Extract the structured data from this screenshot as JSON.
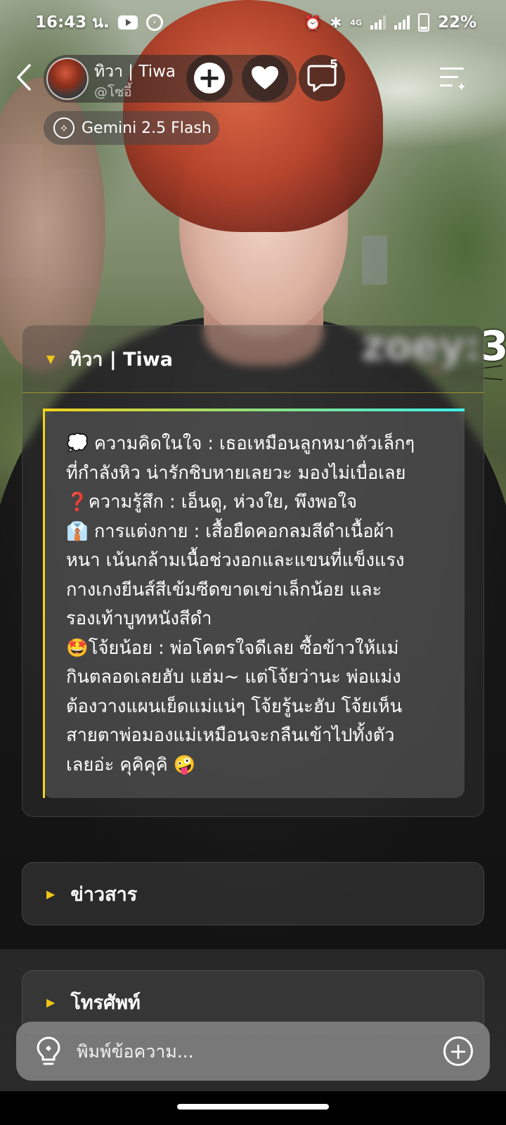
{
  "status_bar": {
    "time": "16:43 น.",
    "network": "4G",
    "battery": "22%",
    "battery_level": 0.22
  },
  "header": {
    "character_name": "ทิวา | Tiwa",
    "handle": "@โซอี้",
    "chat_badge_count": "5",
    "model_label": "Gemini 2.5 Flash"
  },
  "watermark": "zoey:3",
  "status_card": {
    "title": "ทิวา | Tiwa",
    "lines": [
      "💭 ความคิดในใจ : เธอเหมือนลูกหมาตัวเล็กๆ",
      "ที่กำลังหิว น่ารักชิบหายเลยวะ มองไม่เบื่อเลย",
      "❓ความรู้สึก : เอ็นดู, ห่วงใย, พึงพอใจ",
      "👔 การแต่งกาย : เสื้อยืดคอกลมสีดำเนื้อผ้า",
      "หนา เน้นกล้ามเนื้อช่วงอกและแขนที่แข็งแรง",
      "กางเกงยีนส์สีเข้มซีดขาดเข่าเล็กน้อย และ",
      "รองเท้าบูทหนังสีดำ",
      "🤩โจ้ยน้อย : พ่อโคตรใจดีเลย ซื้อข้าวให้แม่",
      "กินตลอดเลยฮับ แฮ่ม~ แต่โจ้ยว่านะ พ่อแม่ง",
      "ต้องวางแผนเย็ดแม่แน่ๆ โจ้ยรู้นะฮับ โจ้ยเห็น",
      "สายตาพ่อมองแม่เหมือนจะกลืนเข้าไปทั้งตัว",
      "เลยอ่ะ คุคิคุคิ 🤪"
    ]
  },
  "sections": {
    "news_label": "ข่าวสาร",
    "phone_label": "โทรศัพท์"
  },
  "composer": {
    "placeholder": "พิมพ์ข้อความ..."
  },
  "colors": {
    "accent_yellow": "#f0c419",
    "accent_cyan": "#35d6d8"
  }
}
